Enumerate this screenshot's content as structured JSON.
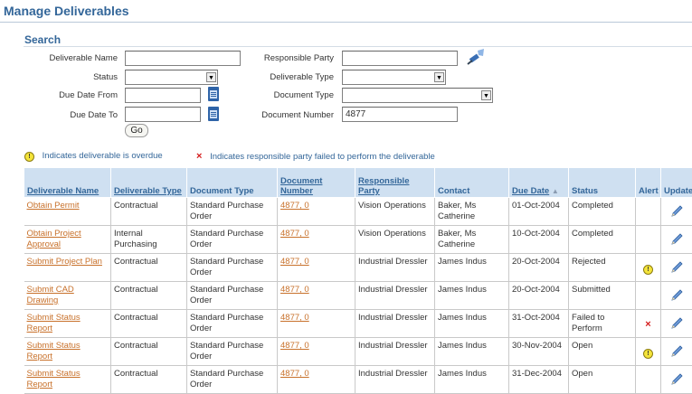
{
  "header": {
    "title": "Manage Deliverables"
  },
  "search": {
    "title": "Search",
    "deliverable_name_label": "Deliverable Name",
    "deliverable_name_value": "",
    "status_label": "Status",
    "status_value": "",
    "due_date_from_label": "Due Date From",
    "due_date_from_value": "",
    "due_date_to_label": "Due Date To",
    "due_date_to_value": "",
    "responsible_party_label": "Responsible Party",
    "responsible_party_value": "",
    "deliverable_type_label": "Deliverable Type",
    "deliverable_type_value": "",
    "document_type_label": "Document Type",
    "document_type_value": "",
    "document_number_label": "Document Number",
    "document_number_value": "4877",
    "go_label": "Go"
  },
  "legend": {
    "overdue_text": "Indicates deliverable is overdue",
    "failed_text": "Indicates responsible party failed to perform the deliverable"
  },
  "table": {
    "headers": {
      "name": "Deliverable Name",
      "type": "Deliverable Type",
      "doc_type": "Document Type",
      "doc_number": "Document Number",
      "party": "Responsible Party",
      "contact": "Contact",
      "due_date": "Due Date",
      "status": "Status",
      "alert": "Alert",
      "update": "Update"
    },
    "rows": [
      {
        "name": "Obtain Permit",
        "type": "Contractual",
        "doc_type": "Standard Purchase Order",
        "doc_number": "4877, 0",
        "party": "Vision Operations",
        "contact": "Baker, Ms Catherine",
        "due_date": "01-Oct-2004",
        "status": "Completed",
        "alert": ""
      },
      {
        "name": "Obtain Project Approval",
        "type": "Internal Purchasing",
        "doc_type": "Standard Purchase Order",
        "doc_number": "4877, 0",
        "party": "Vision Operations",
        "contact": "Baker, Ms Catherine",
        "due_date": "10-Oct-2004",
        "status": "Completed",
        "alert": ""
      },
      {
        "name": "Submit Project Plan",
        "type": "Contractual",
        "doc_type": "Standard Purchase Order",
        "doc_number": "4877, 0",
        "party": "Industrial Dressler",
        "contact": "James Indus",
        "due_date": "20-Oct-2004",
        "status": "Rejected",
        "alert": "overdue"
      },
      {
        "name": "Submit CAD Drawing",
        "type": "Contractual",
        "doc_type": "Standard Purchase Order",
        "doc_number": "4877, 0",
        "party": "Industrial Dressler",
        "contact": "James Indus",
        "due_date": "20-Oct-2004",
        "status": "Submitted",
        "alert": ""
      },
      {
        "name": "Submit Status Report",
        "type": "Contractual",
        "doc_type": "Standard Purchase Order",
        "doc_number": "4877, 0",
        "party": "Industrial Dressler",
        "contact": "James Indus",
        "due_date": "31-Oct-2004",
        "status": "Failed to Perform",
        "alert": "failed"
      },
      {
        "name": "Submit Status Report",
        "type": "Contractual",
        "doc_type": "Standard Purchase Order",
        "doc_number": "4877, 0",
        "party": "Industrial Dressler",
        "contact": "James Indus",
        "due_date": "30-Nov-2004",
        "status": "Open",
        "alert": "overdue"
      },
      {
        "name": "Submit Status Report",
        "type": "Contractual",
        "doc_type": "Standard Purchase Order",
        "doc_number": "4877, 0",
        "party": "Industrial Dressler",
        "contact": "James Indus",
        "due_date": "31-Dec-2004",
        "status": "Open",
        "alert": ""
      }
    ]
  },
  "colors": {
    "brand_blue": "#336699",
    "header_bg": "#cfe0f1",
    "link_orange": "#c8712b",
    "failed_red": "#d41c1c"
  }
}
